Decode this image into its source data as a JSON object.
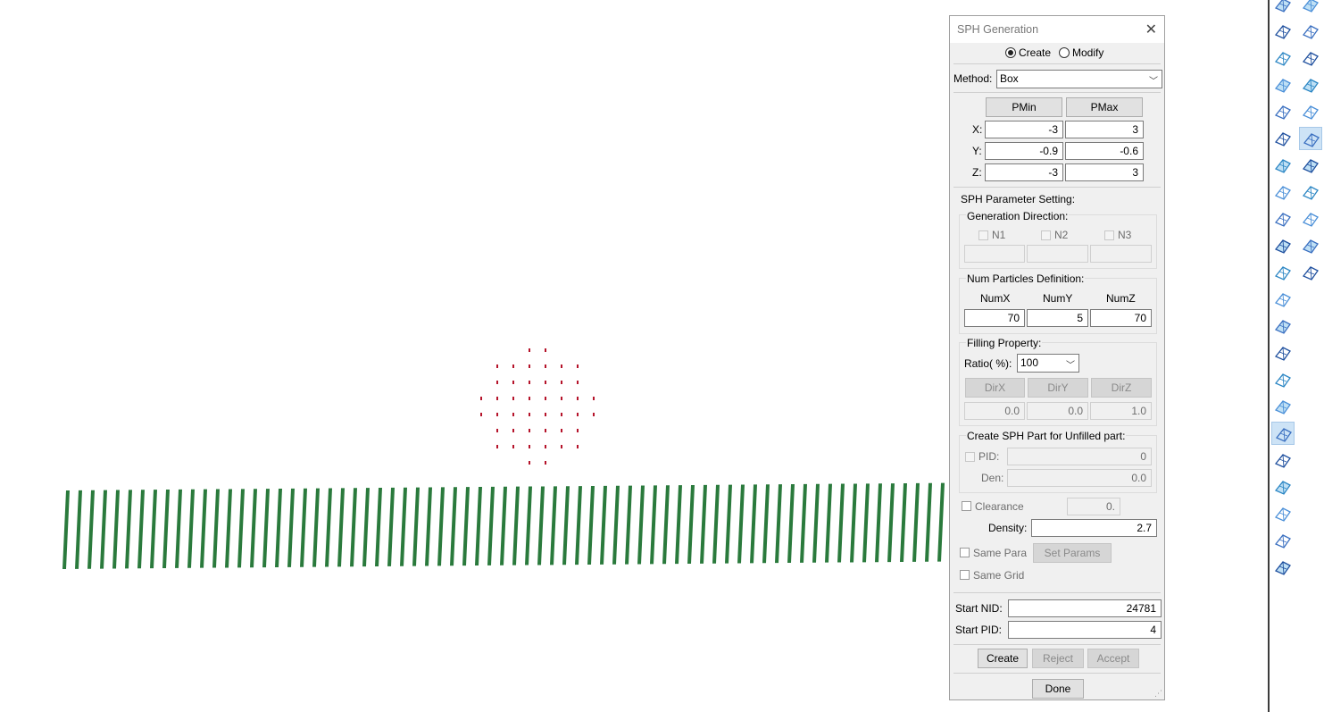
{
  "dialog": {
    "title": "SPH Generation",
    "mode": {
      "create_label": "Create",
      "modify_label": "Modify",
      "selected": "Create"
    },
    "method": {
      "label": "Method:",
      "value": "Box"
    },
    "bounds": {
      "pmin_label": "PMin",
      "pmax_label": "PMax",
      "x_label": "X:",
      "y_label": "Y:",
      "z_label": "Z:",
      "x_min": "-3",
      "x_max": "3",
      "y_min": "-0.9",
      "y_max": "-0.6",
      "z_min": "-3",
      "z_max": "3"
    },
    "sph_param_label": "SPH Parameter Setting:",
    "gen_direction": {
      "label": "Generation Direction:",
      "n1": "N1",
      "n2": "N2",
      "n3": "N3"
    },
    "num_particles": {
      "label": "Num Particles Definition:",
      "numx_label": "NumX",
      "numy_label": "NumY",
      "numz_label": "NumZ",
      "numx": "70",
      "numy": "5",
      "numz": "70"
    },
    "filling": {
      "label": "Filling Property:",
      "ratio_label": "Ratio( %):",
      "ratio": "100",
      "dirx_label": "DirX",
      "diry_label": "DirY",
      "dirz_label": "DirZ",
      "dirx": "0.0",
      "diry": "0.0",
      "dirz": "1.0"
    },
    "unfilled": {
      "label": "Create SPH Part for Unfilled part:",
      "pid_label": "PID:",
      "pid": "0",
      "den_label": "Den:",
      "den": "0.0"
    },
    "clearance_label": "Clearance",
    "clearance": "0.",
    "density_label": "Density:",
    "density": "2.7",
    "same_para_label": "Same Para",
    "set_params_label": "Set Params",
    "same_grid_label": "Same Grid",
    "start_nid_label": "Start NID:",
    "start_nid": "24781",
    "start_pid_label": "Start PID:",
    "start_pid": "4",
    "create_label": "Create",
    "reject_label": "Reject",
    "accept_label": "Accept",
    "done_label": "Done"
  },
  "colors": {
    "sphere_particles": "#b5132a",
    "slab_particles": "#2a7a3c",
    "selected_tool": "#cde3f6"
  },
  "toolbar_icons": [
    "box-icon",
    "curve-icon",
    "surface-mesh-icon",
    "plane-icon",
    "mesh-grid-icon",
    "sphere-solid-icon",
    "cube-solid-icon",
    "solid-map-icon",
    "node-mesh-icon",
    "sph-mesh-icon",
    "axis-mesh-icon",
    "layers-icon",
    "triangle-mesh-icon",
    "grid-settings-icon",
    "quad-grid-icon",
    "magnet-icon",
    "magnet-u-icon",
    "spark-grid-icon",
    "ms-icon",
    "pencil-icon",
    "stethoscope-icon",
    "search-mesh-icon",
    "report-icon",
    "rotate-mesh-icon",
    "cube-mesh-icon",
    "m-node-icon",
    "align-icon",
    "sph-particles-icon",
    "particle-cube-icon",
    "ms-small-icon",
    "contour-icon",
    "transfer-icon",
    "mesh-check-icon"
  ]
}
